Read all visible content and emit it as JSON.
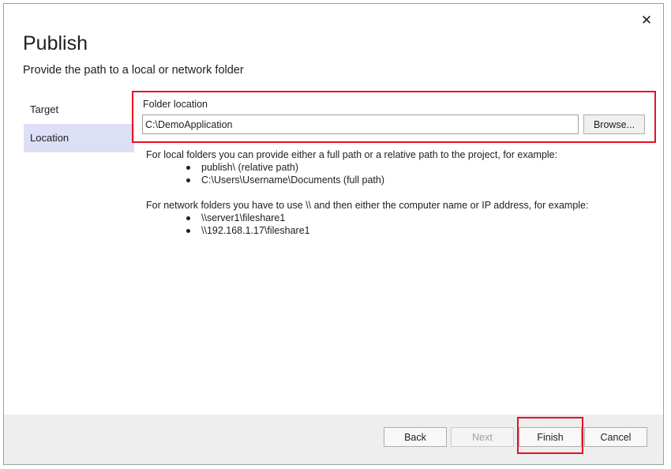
{
  "dialog": {
    "title": "Publish",
    "subtitle": "Provide the path to a local or network folder",
    "close_glyph": "✕"
  },
  "nav": {
    "items": [
      {
        "label": "Target",
        "selected": false
      },
      {
        "label": "Location",
        "selected": true
      }
    ]
  },
  "folder": {
    "label": "Folder location",
    "value": "C:\\DemoApplication",
    "browse_label": "Browse..."
  },
  "help": {
    "local_intro": "For local folders you can provide either a full path or a relative path to the project, for example:",
    "local_examples": [
      "publish\\ (relative path)",
      "C:\\Users\\Username\\Documents (full path)"
    ],
    "network_intro": "For network folders you have to use \\\\ and then either the computer name or IP address, for example:",
    "network_examples": [
      "\\\\server1\\fileshare1",
      "\\\\192.168.1.17\\fileshare1"
    ]
  },
  "footer": {
    "back_label": "Back",
    "next_label": "Next",
    "finish_label": "Finish",
    "cancel_label": "Cancel"
  },
  "colors": {
    "highlight": "#e81123",
    "nav_selected": "#dcdff5",
    "footer_bg": "#eeeeee"
  },
  "icons": {
    "close": "close-icon"
  }
}
